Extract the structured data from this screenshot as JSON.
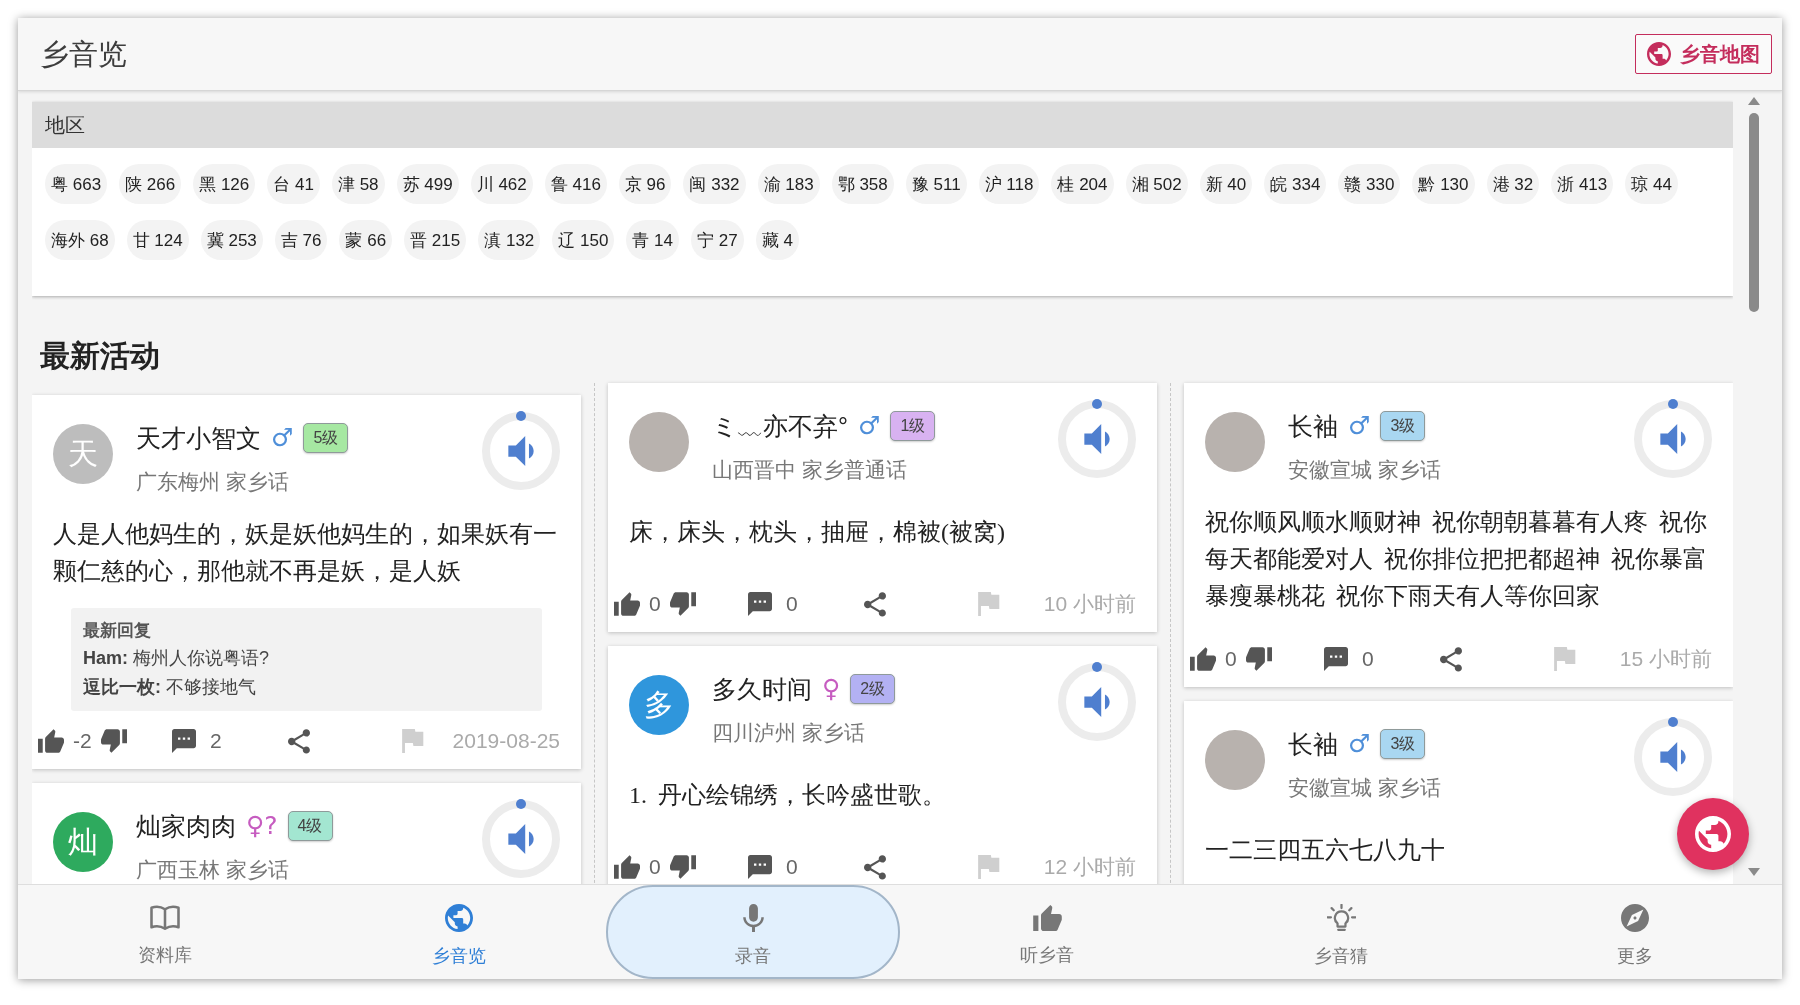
{
  "header": {
    "title": "乡音览",
    "map_button": "乡音地图"
  },
  "regions": {
    "title": "地区",
    "items": [
      {
        "name": "粤",
        "count": "663"
      },
      {
        "name": "陕",
        "count": "266"
      },
      {
        "name": "黑",
        "count": "126"
      },
      {
        "name": "台",
        "count": "41"
      },
      {
        "name": "津",
        "count": "58"
      },
      {
        "name": "苏",
        "count": "499"
      },
      {
        "name": "川",
        "count": "462"
      },
      {
        "name": "鲁",
        "count": "416"
      },
      {
        "name": "京",
        "count": "96"
      },
      {
        "name": "闽",
        "count": "332"
      },
      {
        "name": "渝",
        "count": "183"
      },
      {
        "name": "鄂",
        "count": "358"
      },
      {
        "name": "豫",
        "count": "511"
      },
      {
        "name": "沪",
        "count": "118"
      },
      {
        "name": "桂",
        "count": "204"
      },
      {
        "name": "湘",
        "count": "502"
      },
      {
        "name": "新",
        "count": "40"
      },
      {
        "name": "皖",
        "count": "334"
      },
      {
        "name": "赣",
        "count": "330"
      },
      {
        "name": "黔",
        "count": "130"
      },
      {
        "name": "港",
        "count": "32"
      },
      {
        "name": "浙",
        "count": "413"
      },
      {
        "name": "琼",
        "count": "44"
      },
      {
        "name": "海外",
        "count": "68"
      },
      {
        "name": "甘",
        "count": "124"
      },
      {
        "name": "冀",
        "count": "253"
      },
      {
        "name": "吉",
        "count": "76"
      },
      {
        "name": "蒙",
        "count": "66"
      },
      {
        "name": "晋",
        "count": "215"
      },
      {
        "name": "滇",
        "count": "132"
      },
      {
        "name": "辽",
        "count": "150"
      },
      {
        "name": "青",
        "count": "14"
      },
      {
        "name": "宁",
        "count": "27"
      },
      {
        "name": "藏",
        "count": "4"
      }
    ]
  },
  "latest": {
    "title": "最新活动",
    "columns": [
      {
        "cards": [
          {
            "avatar": {
              "kind": "letter",
              "text": "天",
              "color": "#bdbdbd"
            },
            "name": "天才小智文",
            "gender": {
              "symbol": "♂",
              "kind": "male"
            },
            "level": {
              "text": "5级",
              "color": "#a6e8a2"
            },
            "location": "广东梅州 家乡话",
            "body": "人是人他妈生的，妖是妖他妈生的，如果妖有一颗仁慈的心，那他就不再是妖，是人妖",
            "reply": {
              "title": "最新回复",
              "lines": [
                "**Ham:** 梅州人你说粤语?",
                "**逗比一枚:** 不够接地气"
              ]
            },
            "likes": "-2",
            "comments": "2",
            "time": "2019-08-25"
          },
          {
            "avatar": {
              "kind": "letter",
              "text": "灿",
              "color": "#2eaa5e"
            },
            "name": "灿家肉肉",
            "gender": {
              "symbol": "♀?",
              "kind": "female"
            },
            "level": {
              "text": "4级",
              "color": "#a3e6d1"
            },
            "location": "广西玉林 家乡话"
          }
        ]
      },
      {
        "cards": [
          {
            "avatar": {
              "kind": "photo"
            },
            "name": "ミ﹏亦不弃°",
            "gender": {
              "symbol": "♂",
              "kind": "male"
            },
            "level": {
              "text": "1级",
              "color": "#d8b2f1"
            },
            "location": "山西晋中 家乡普通话",
            "body": "床，床头，枕头，抽屉，棉被(被窝)",
            "likes": "0",
            "comments": "0",
            "time": "10 小时前"
          },
          {
            "avatar": {
              "kind": "letter",
              "text": "多",
              "color": "#2f96dc"
            },
            "name": "多久时间",
            "gender": {
              "symbol": "♀",
              "kind": "female"
            },
            "level": {
              "text": "2级",
              "color": "#b3b1f3"
            },
            "location": "四川泸州 家乡话",
            "body": "1. 丹心绘锦绣，长吟盛世歌。",
            "likes": "0",
            "comments": "0",
            "time": "12 小时前"
          }
        ]
      },
      {
        "cards": [
          {
            "avatar": {
              "kind": "photo"
            },
            "name": "长袖",
            "gender": {
              "symbol": "♂",
              "kind": "male"
            },
            "level": {
              "text": "3级",
              "color": "#a9d7f1"
            },
            "location": "安徽宣城 家乡话",
            "body": "祝你顺风顺水顺财神 祝你朝朝暮暮有人疼 祝你每天都能爱对人 祝你排位把把都超神 祝你暴富暴瘦暴桃花 祝你下雨天有人等你回家",
            "likes": "0",
            "comments": "0",
            "time": "15 小时前"
          },
          {
            "avatar": {
              "kind": "photo"
            },
            "name": "长袖",
            "gender": {
              "symbol": "♂",
              "kind": "male"
            },
            "level": {
              "text": "3级",
              "color": "#a9d7f1"
            },
            "location": "安徽宣城 家乡话",
            "body": "一二三四五六七八九十"
          }
        ]
      }
    ]
  },
  "bottom_nav": [
    {
      "label": "资料库",
      "kind": "tab",
      "selected": false
    },
    {
      "label": "乡音览",
      "kind": "tab",
      "selected": true
    },
    {
      "label": "录音",
      "kind": "record",
      "selected": false
    },
    {
      "label": "听乡音",
      "kind": "tab",
      "selected": false
    },
    {
      "label": "乡音猜",
      "kind": "tab",
      "selected": false
    },
    {
      "label": "更多",
      "kind": "tab",
      "selected": false
    }
  ]
}
